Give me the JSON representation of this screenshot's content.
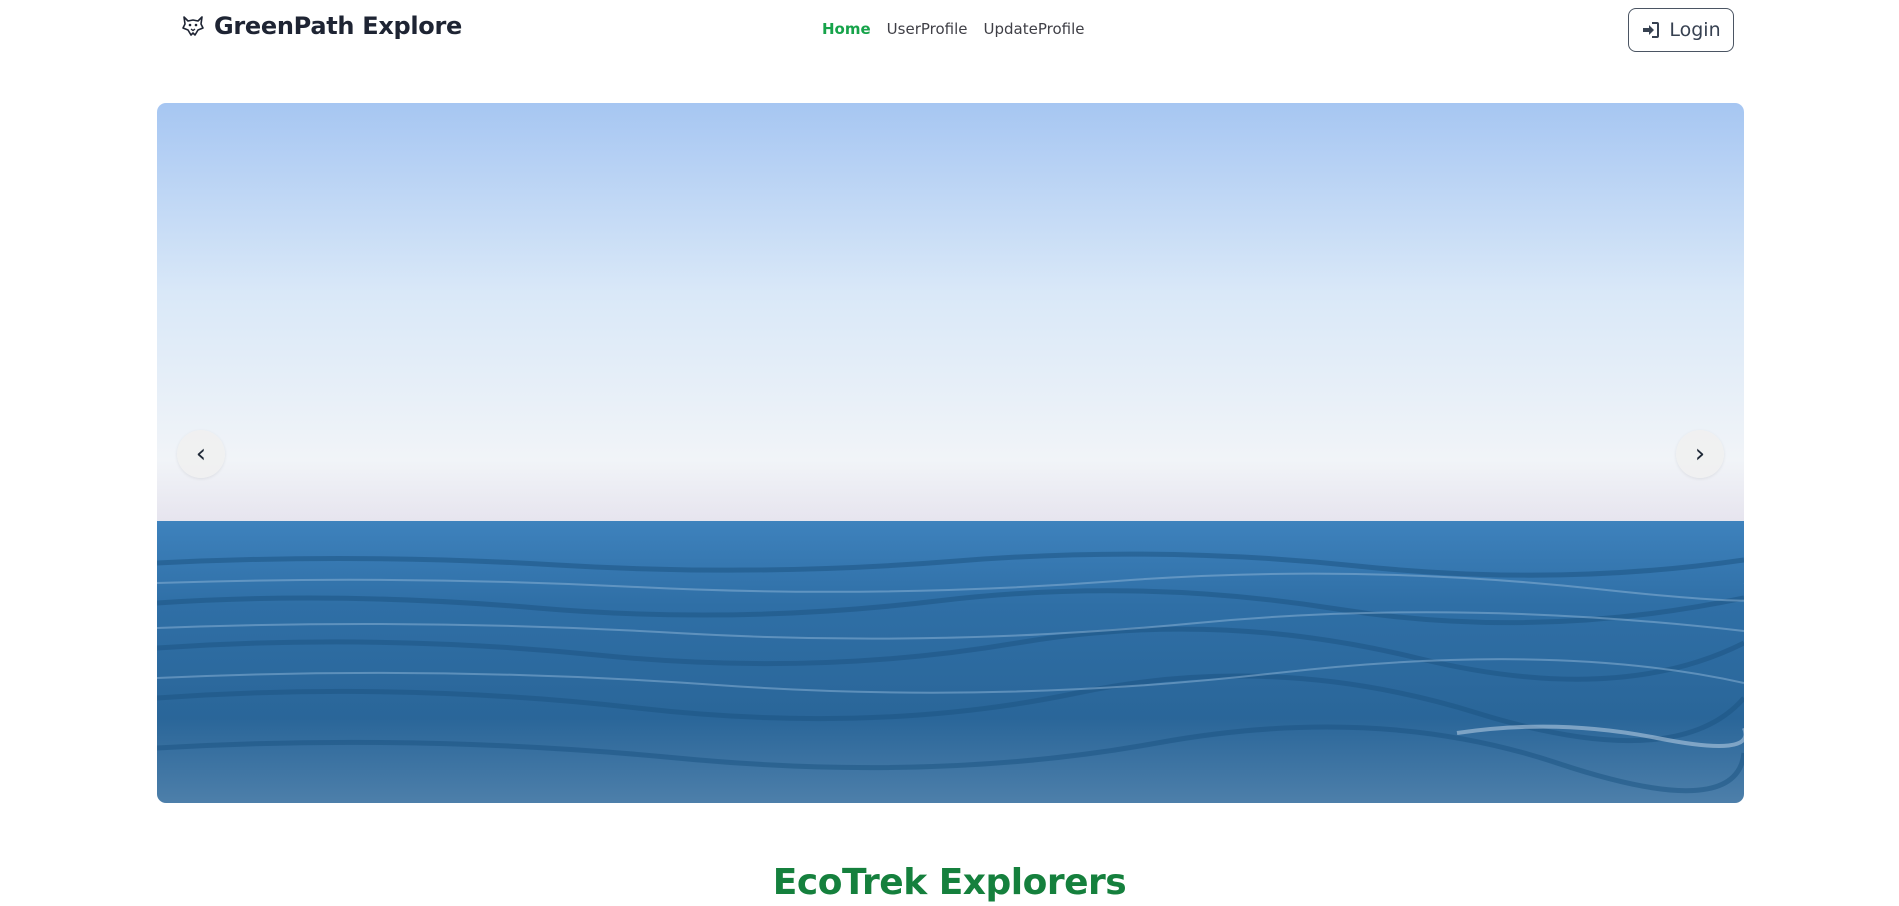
{
  "header": {
    "brand_name": "GreenPath Explore",
    "brand_icon": "wolf-logo-icon",
    "nav": [
      {
        "label": "Home",
        "active": true
      },
      {
        "label": "UserProfile",
        "active": false
      },
      {
        "label": "UpdateProfile",
        "active": false
      }
    ],
    "login_label": "Login",
    "login_icon": "sign-in-icon"
  },
  "carousel": {
    "prev_label": "‹",
    "next_label": "›",
    "image_subject": "ocean-horizon"
  },
  "section": {
    "title": "EcoTrek Explorers"
  },
  "colors": {
    "accent": "#16a34a",
    "title_green": "#15803d",
    "text": "#1e2433"
  }
}
